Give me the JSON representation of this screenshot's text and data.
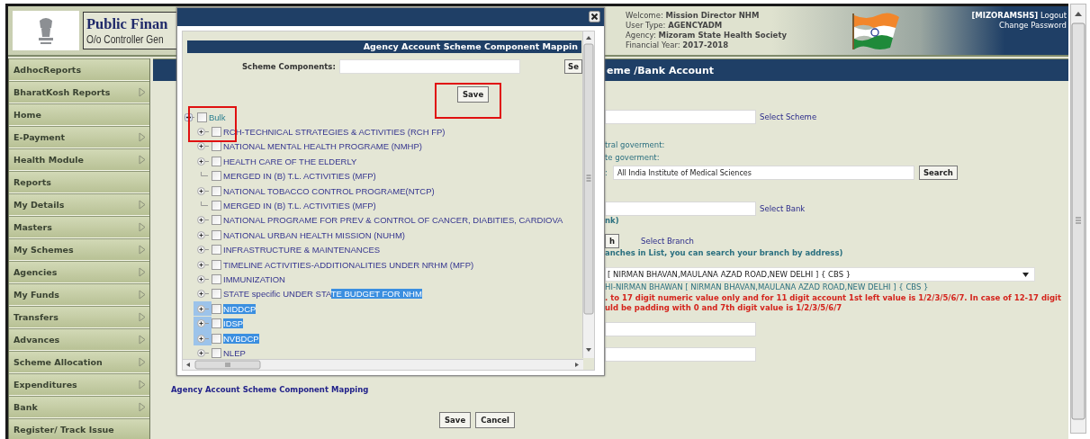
{
  "header": {
    "title": "Public Finan",
    "subtitle": "O/o Controller Gen",
    "welcome": [
      "Welcome: **Mission Director NHM**",
      "User Type: **AGENCYADM**",
      "Agency: **Mizoram State Health Society**",
      "Financial Year: **2017-2018**"
    ],
    "user": "[MIZORAMSHS]",
    "logout": "Logout",
    "change_password": "Change Password"
  },
  "sidebar": {
    "items": [
      {
        "label": "AdhocReports",
        "has_submenu": false
      },
      {
        "label": "BharatKosh Reports",
        "has_submenu": true
      },
      {
        "label": "Home",
        "has_submenu": false
      },
      {
        "label": "E-Payment",
        "has_submenu": true
      },
      {
        "label": "Health Module",
        "has_submenu": true
      },
      {
        "label": "Reports",
        "has_submenu": false
      },
      {
        "label": "My Details",
        "has_submenu": true
      },
      {
        "label": "Masters",
        "has_submenu": true
      },
      {
        "label": "My Schemes",
        "has_submenu": true
      },
      {
        "label": "Agencies",
        "has_submenu": true
      },
      {
        "label": "My Funds",
        "has_submenu": true
      },
      {
        "label": "Transfers",
        "has_submenu": true
      },
      {
        "label": "Advances",
        "has_submenu": true
      },
      {
        "label": "Scheme Allocation",
        "has_submenu": true
      },
      {
        "label": "Expenditures",
        "has_submenu": true
      },
      {
        "label": "Bank",
        "has_submenu": true
      },
      {
        "label": "Register/ Track Issue",
        "has_submenu": false
      }
    ]
  },
  "main": {
    "section_title": "eme /Bank Account",
    "rows": [
      {
        "kind": "field_link",
        "link": "Select Scheme"
      },
      {
        "kind": "text",
        "text": "tral goverment:"
      },
      {
        "kind": "text",
        "text": "te goverment:"
      },
      {
        "kind": "field_button",
        "label": ":",
        "value": "All India Institute of Medical Sciences",
        "button": "Search"
      },
      {
        "kind": "field_link",
        "link": "Select Bank"
      },
      {
        "kind": "note",
        "text": "nk)"
      },
      {
        "kind": "button_link",
        "button": "h",
        "link": "Select Branch"
      },
      {
        "kind": "note",
        "text": "anches in List, you can search your branch by address)"
      },
      {
        "kind": "select",
        "value": "[ NIRMAN BHAVAN,MAULANA AZAD ROAD,NEW DELHI ] { CBS }"
      },
      {
        "kind": "info",
        "text": "HI-NIRMAN BHAWAN [ NIRMAN BHAVAN,MAULANA AZAD ROAD,NEW DELHI ] { CBS }"
      },
      {
        "kind": "error",
        "text": ". to 17 digit numeric value only and for 11 digit account 1st left value is 1/2/3/5/6/7. In case of 12-17 digit"
      },
      {
        "kind": "error",
        "text": "uld be padding with 0 and 7th digit value is 1/2/3/5/6/7"
      },
      {
        "kind": "field"
      },
      {
        "kind": "field"
      }
    ]
  },
  "dialog": {
    "heading": "Agency Account Scheme Component Mappin",
    "search_label": "Scheme Components:",
    "search_button": "Se",
    "save_button": "Save",
    "tree": {
      "label": [
        {
          "text": "Bulk",
          "highlighted": false
        }
      ],
      "expanded": true,
      "checked": false,
      "children": [
        {
          "kind": "branch",
          "checked": false,
          "label": [
            {
              "text": "RCH-TECHNICAL STRATEGIES & ACTIVITIES (RCH FP)",
              "highlighted": false
            }
          ]
        },
        {
          "kind": "branch",
          "checked": false,
          "label": [
            {
              "text": "NATIONAL MENTAL HEALTH PROGRAME (NMHP)",
              "highlighted": false
            }
          ]
        },
        {
          "kind": "branch",
          "checked": false,
          "label": [
            {
              "text": "HEALTH CARE OF THE ELDERLY",
              "highlighted": false
            }
          ]
        },
        {
          "kind": "leaf",
          "checked": false,
          "label": [
            {
              "text": "MERGED IN (B) T.L. ACTIVITIES (MFP)",
              "highlighted": false
            }
          ]
        },
        {
          "kind": "branch",
          "checked": false,
          "label": [
            {
              "text": "NATIONAL TOBACCO CONTROL PROGRAME(NTCP)",
              "highlighted": false
            }
          ]
        },
        {
          "kind": "leaf",
          "checked": false,
          "label": [
            {
              "text": "MERGED IN (B) T.L. ACTIVITIES (MFP)",
              "highlighted": false
            }
          ]
        },
        {
          "kind": "branch",
          "checked": false,
          "label": [
            {
              "text": "NATIONAL PROGRAME FOR PREV & CONTROL OF CANCER, DIABITIES, CARDIOVA",
              "highlighted": false
            }
          ]
        },
        {
          "kind": "branch",
          "checked": false,
          "label": [
            {
              "text": "NATIONAL URBAN HEALTH MISSION (NUHM)",
              "highlighted": false
            }
          ]
        },
        {
          "kind": "branch",
          "checked": false,
          "label": [
            {
              "text": "INFRASTRUCTURE & MAINTENANCES",
              "highlighted": false
            }
          ]
        },
        {
          "kind": "branch",
          "checked": false,
          "label": [
            {
              "text": "TIMELINE ACTIVITIES-ADDITIONALITIES UNDER NRHM (MFP)",
              "highlighted": false
            }
          ]
        },
        {
          "kind": "branch",
          "checked": false,
          "label": [
            {
              "text": "IMMUNIZATION",
              "highlighted": false
            }
          ]
        },
        {
          "kind": "branch",
          "checked": false,
          "label": [
            {
              "text": "STATE specific UNDER STA",
              "highlighted": false
            },
            {
              "text": "TE BUDGET FOR NHM",
              "highlighted": true
            }
          ]
        },
        {
          "kind": "branch",
          "checked": false,
          "label": [
            {
              "text": "NIDDCP",
              "highlighted": true
            }
          ]
        },
        {
          "kind": "branch",
          "checked": false,
          "label": [
            {
              "text": "IDSP",
              "highlighted": true
            }
          ]
        },
        {
          "kind": "branch",
          "checked": false,
          "label": [
            {
              "text": "NVBDCP",
              "highlighted": true
            }
          ]
        },
        {
          "kind": "branch",
          "checked": false,
          "label": [
            {
              "text": "NLEP",
              "highlighted": false
            }
          ]
        }
      ]
    }
  },
  "footer": {
    "link": "Agency Account Scheme Component Mapping",
    "buttons": [
      "Save",
      "Cancel"
    ]
  }
}
